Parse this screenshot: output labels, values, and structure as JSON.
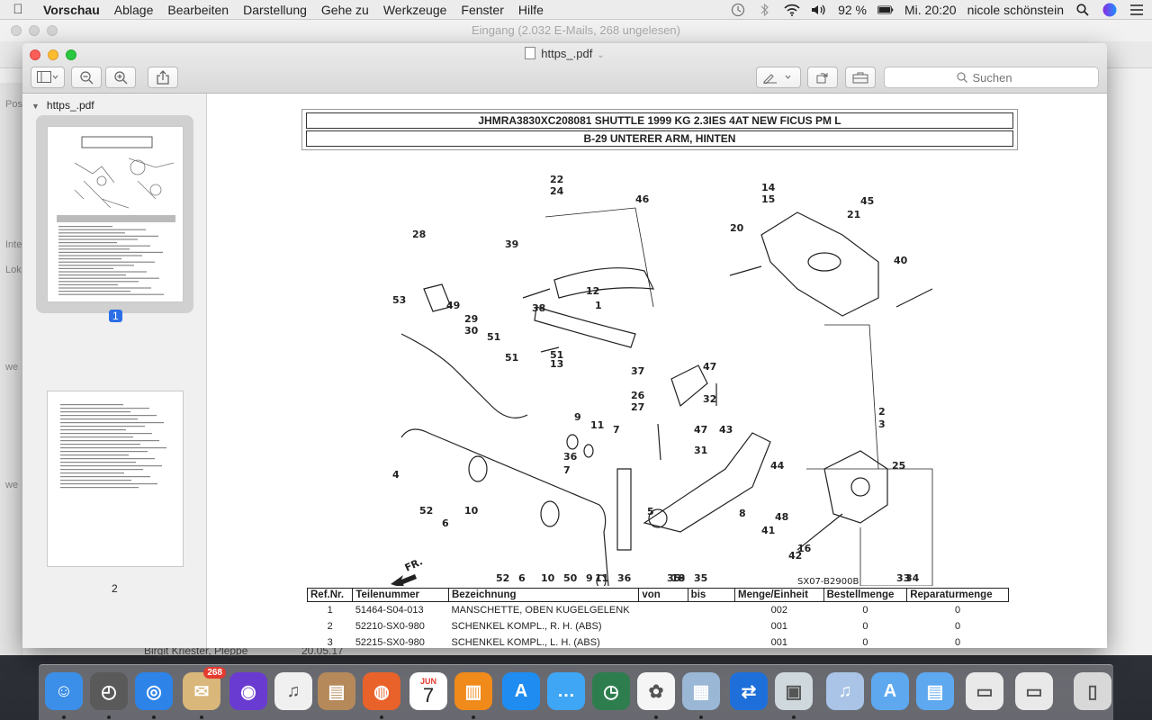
{
  "menubar": {
    "app": "Vorschau",
    "items": [
      "Ablage",
      "Bearbeiten",
      "Darstellung",
      "Gehe zu",
      "Werkzeuge",
      "Fenster",
      "Hilfe"
    ],
    "battery": "92 %",
    "clock": "Mi. 20:20",
    "user": "nicole schönstein"
  },
  "mail_window": {
    "title": "Eingang (2.032 E-Mails, 268 ungelesen)",
    "sidebar_labels": [
      "Pos",
      "Inte",
      "Lok",
      "we",
      "we"
    ],
    "bottom_row": {
      "sender": "Birgit Kriester, Pleppe",
      "date": "20.05.17"
    }
  },
  "preview": {
    "filename": "https_.pdf",
    "search_placeholder": "Suchen",
    "sidebar_title": "https_.pdf",
    "pages": [
      {
        "number": "1",
        "selected": true
      },
      {
        "number": "2",
        "selected": false
      }
    ]
  },
  "document": {
    "header_line1": "JHMRA3830XC208081 SHUTTLE 1999 KG 2.3IES 4AT NEW FICUS PM L",
    "header_line2": "B-29 UNTERER ARM, HINTEN",
    "diagram_code": "SX07-B2900B",
    "direction_label": "FR.",
    "part_labels": [
      "22",
      "24",
      "46",
      "14",
      "15",
      "45",
      "21",
      "20",
      "40",
      "28",
      "39",
      "12",
      "1",
      "53",
      "49",
      "29",
      "30",
      "51",
      "38",
      "51",
      "13",
      "37",
      "47",
      "51",
      "26",
      "27",
      "32",
      "9",
      "11",
      "36",
      "7",
      "47",
      "31",
      "43",
      "2",
      "3",
      "4",
      "52",
      "6",
      "10",
      "7",
      "44",
      "8",
      "41",
      "48",
      "25",
      "5",
      "52",
      "6",
      "10",
      "35",
      "35",
      "42",
      "16",
      "34",
      "33",
      "50",
      "9",
      "11",
      "36",
      "18",
      "19"
    ],
    "table_headers": [
      "Ref.Nr.",
      "Teilenummer",
      "Bezeichnung",
      "von",
      "bis",
      "Menge/Einheit",
      "Bestellmenge",
      "Reparaturmenge"
    ],
    "table_rows": [
      {
        "ref": "1",
        "part": "51464-S04-013",
        "desc": "MANSCHETTE, OBEN KUGELGELENK",
        "qty": "002",
        "order": "0",
        "repair": "0"
      },
      {
        "ref": "2",
        "part": "52210-SX0-980",
        "desc": "SCHENKEL KOMPL., R. H. (ABS)",
        "qty": "001",
        "order": "0",
        "repair": "0"
      },
      {
        "ref": "3",
        "part": "52215-SX0-980",
        "desc": "SCHENKEL KOMPL., L. H. (ABS)",
        "qty": "001",
        "order": "0",
        "repair": "0"
      }
    ]
  },
  "dock": {
    "apps": [
      "Finder",
      "Launchpad",
      "Safari",
      "Mail",
      "Siri",
      "iTunes",
      "Kontakte",
      "Firefox",
      "Kalender",
      "iBooks",
      "App Store",
      "Nachrichten",
      "Time Machine",
      "Fotos",
      "Vorschau-Bilder",
      "TeamViewer",
      "Vorschau",
      "iTunes-Ordner",
      "Programme",
      "Dokumente",
      "Bild 1",
      "Bild 2",
      "Papierkorb"
    ],
    "mail_badge": "268",
    "calendar_month": "JUN",
    "calendar_day": "7"
  }
}
